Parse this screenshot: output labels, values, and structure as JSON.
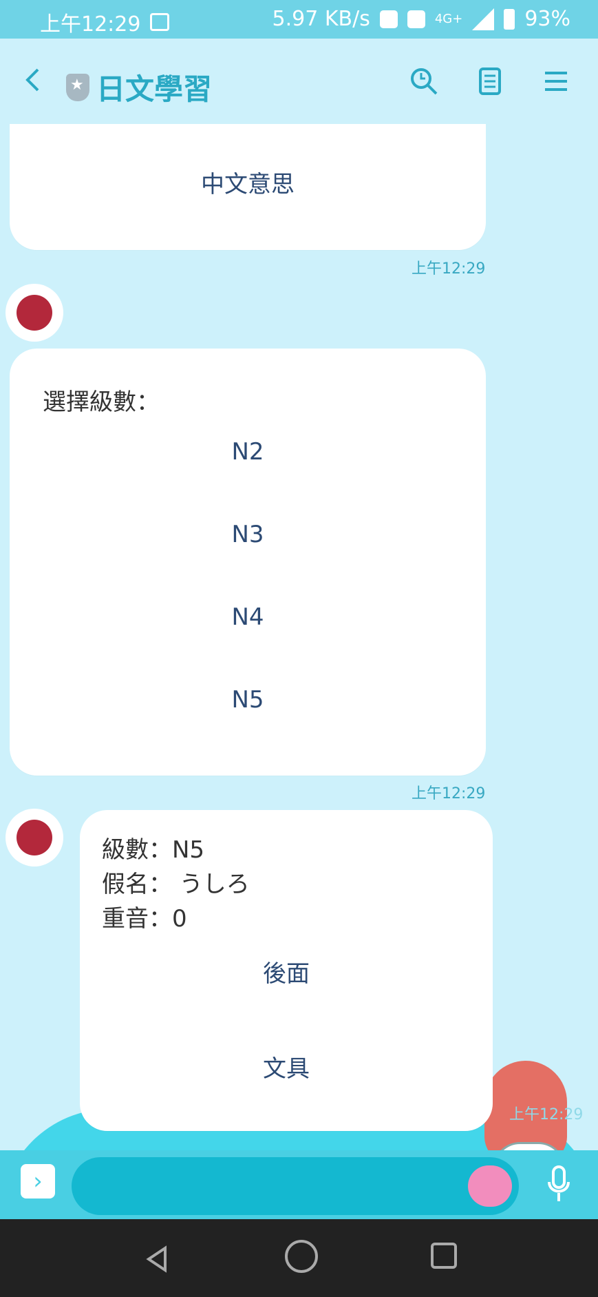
{
  "status_bar": {
    "time": "上午12:29",
    "speed": "5.97 KB/s",
    "network": "4G+",
    "battery": "93%"
  },
  "header": {
    "title": "日文學習"
  },
  "messages": [
    {
      "type": "card",
      "option": "中文意思",
      "time": "上午12:29"
    },
    {
      "type": "options",
      "label": "選擇級數：",
      "options": [
        "N2",
        "N3",
        "N4",
        "N5"
      ],
      "time": "上午12:29"
    },
    {
      "type": "flashcard",
      "level_line": "級數：N5",
      "kana_line": "假名： うしろ",
      "accent_line": "重音：0",
      "actions": [
        "後面",
        "文具"
      ],
      "time": "上午12:29"
    }
  ]
}
